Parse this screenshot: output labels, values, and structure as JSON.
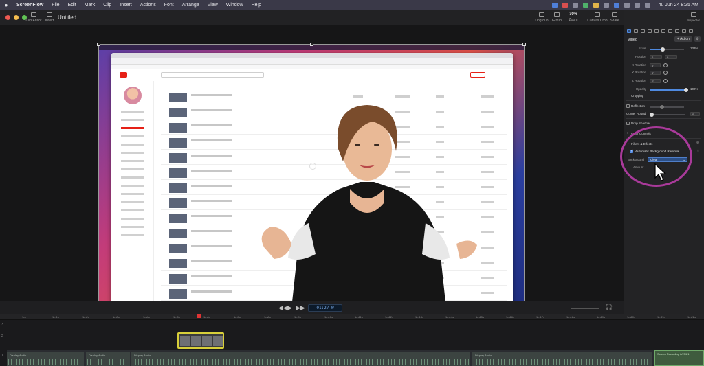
{
  "menubar": {
    "app_name": "ScreenFlow",
    "items": [
      "File",
      "Edit",
      "Mark",
      "Clip",
      "Insert",
      "Actions",
      "Font",
      "Arrange",
      "View",
      "Window",
      "Help"
    ],
    "clock": "Thu Jun 24  8:25 AM"
  },
  "toolbar": {
    "document_title": "Untitled",
    "clip_editor": "Clip Editor",
    "insert": "Insert",
    "ungroup": "Ungroup",
    "group": "Group",
    "zoom_value": "70%",
    "zoom": "Zoom",
    "canvas_crop": "Canvas Crop",
    "share": "Share"
  },
  "transport": {
    "timecode": "01:27 W"
  },
  "timeline": {
    "ruler_labels": [
      "1m",
      "1m1s",
      "1m2s",
      "1m3s",
      "1m4s",
      "1m5s",
      "1m6s",
      "1m7s",
      "1m8s",
      "1m9s",
      "1m10s",
      "1m11s",
      "1m12s",
      "1m13s",
      "1m14s",
      "1m15s",
      "1m16s",
      "1m17s",
      "1m18s",
      "1m19s",
      "1m20s",
      "1m21s",
      "1m22s"
    ],
    "track_numbers": [
      "3",
      "2",
      "1"
    ],
    "audio_clips": [
      "Display Audio",
      "Display Audio",
      "Display Audio",
      "Display Audio"
    ],
    "recording_clip": "Screen Recording 6/23/21"
  },
  "inspector": {
    "title": "Inspector",
    "section_video": "Video",
    "action_button": "+ Action",
    "scale_label": "Scale",
    "scale_value": "133%",
    "position_label": "Position",
    "position_x": "0",
    "position_y": "0",
    "x_rotation_label": "X Rotation",
    "x_rotation_value": "0°",
    "y_rotation_label": "Y Rotation",
    "y_rotation_value": "0°",
    "z_rotation_label": "Z Rotation",
    "z_rotation_value": "0°",
    "opacity_label": "Opacity",
    "opacity_value": "100%",
    "cropping": "Cropping",
    "reflection": "Reflection",
    "corner_round": "Corner Round",
    "corner_round_value": "0",
    "drop_shadow": "Drop Shadow",
    "color_controls": "Color Controls",
    "filters_effects": "Filters & Effects",
    "auto_bg_removal": "Automatic Background Removal",
    "background_label": "Background",
    "background_value": "Clear",
    "amount_label": "Amount"
  }
}
